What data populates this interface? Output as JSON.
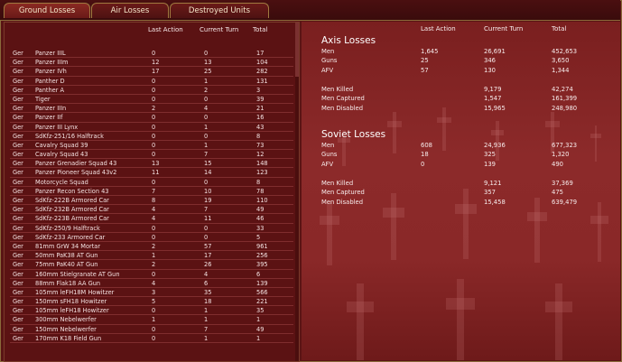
{
  "tabs": [
    {
      "label": "Ground Losses",
      "active": true
    },
    {
      "label": "Air Losses",
      "active": false
    },
    {
      "label": "Destroyed Units",
      "active": false
    }
  ],
  "left_headers": {
    "last_action": "Last Action",
    "current_turn": "Current Turn",
    "total": "Total"
  },
  "ground_rows": [
    [
      "Ger",
      "Panzer IIIL",
      "0",
      "0",
      "17"
    ],
    [
      "Ger",
      "Panzer IIIm",
      "12",
      "13",
      "104"
    ],
    [
      "Ger",
      "Panzer IVh",
      "17",
      "25",
      "282"
    ],
    [
      "Ger",
      "Panther D",
      "0",
      "1",
      "131"
    ],
    [
      "Ger",
      "Panther A",
      "0",
      "2",
      "3"
    ],
    [
      "Ger",
      "Tiger",
      "0",
      "0",
      "39"
    ],
    [
      "Ger",
      "Panzer IIIn",
      "2",
      "4",
      "21"
    ],
    [
      "Ger",
      "Panzer IIf",
      "0",
      "0",
      "16"
    ],
    [
      "Ger",
      "Panzer III Lynx",
      "0",
      "1",
      "43"
    ],
    [
      "Ger",
      "SdKfz-251/16 Halftrack",
      "0",
      "0",
      "8"
    ],
    [
      "Ger",
      "Cavalry Squad 39",
      "0",
      "1",
      "73"
    ],
    [
      "Ger",
      "Cavalry Squad 43",
      "0",
      "7",
      "12"
    ],
    [
      "Ger",
      "Panzer Grenadier Squad 43",
      "13",
      "15",
      "148"
    ],
    [
      "Ger",
      "Panzer Pioneer Squad 43v2",
      "11",
      "14",
      "123"
    ],
    [
      "Ger",
      "Motorcycle Squad",
      "0",
      "0",
      "8"
    ],
    [
      "Ger",
      "Panzer Recon Section 43",
      "7",
      "10",
      "78"
    ],
    [
      "Ger",
      "SdKfz-222B Armored Car",
      "8",
      "19",
      "110"
    ],
    [
      "Ger",
      "SdKfz-232B Armored Car",
      "4",
      "7",
      "49"
    ],
    [
      "Ger",
      "SdKfz-223B Armored Car",
      "4",
      "11",
      "46"
    ],
    [
      "Ger",
      "SdKfz-250/9 Halftrack",
      "0",
      "0",
      "33"
    ],
    [
      "Ger",
      "SdKfz-233 Armored Car",
      "0",
      "0",
      "5"
    ],
    [
      "Ger",
      "81mm GrW 34 Mortar",
      "2",
      "57",
      "961"
    ],
    [
      "Ger",
      "50mm PaK38 AT Gun",
      "1",
      "17",
      "256"
    ],
    [
      "Ger",
      "75mm PaK40 AT Gun",
      "2",
      "26",
      "395"
    ],
    [
      "Ger",
      "160mm Stielgranate AT Gun",
      "0",
      "4",
      "6"
    ],
    [
      "Ger",
      "88mm Flak18 AA Gun",
      "4",
      "6",
      "139"
    ],
    [
      "Ger",
      "105mm leFH18M Howitzer",
      "3",
      "35",
      "566"
    ],
    [
      "Ger",
      "150mm sFH18 Howitzer",
      "5",
      "18",
      "221"
    ],
    [
      "Ger",
      "105mm leFH18 Howitzer",
      "0",
      "1",
      "35"
    ],
    [
      "Ger",
      "300mm Nebelwerfer",
      "1",
      "1",
      "1"
    ],
    [
      "Ger",
      "150mm Nebelwerfer",
      "0",
      "7",
      "49"
    ],
    [
      "Ger",
      "170mm K18 Field Gun",
      "0",
      "1",
      "1"
    ]
  ],
  "right_headers": {
    "last_action": "Last Action",
    "current_turn": "Current Turn",
    "total": "Total"
  },
  "axis": {
    "title": "Axis Losses",
    "rows": [
      [
        "Men",
        "1,645",
        "26,691",
        "452,653"
      ],
      [
        "Guns",
        "25",
        "346",
        "3,650"
      ],
      [
        "AFV",
        "57",
        "130",
        "1,344"
      ]
    ],
    "casualties": [
      [
        "Men Killed",
        "",
        "9,179",
        "42,274"
      ],
      [
        "Men Captured",
        "",
        "1,547",
        "161,399"
      ],
      [
        "Men Disabled",
        "",
        "15,965",
        "248,980"
      ]
    ]
  },
  "soviet": {
    "title": "Soviet Losses",
    "rows": [
      [
        "Men",
        "608",
        "24,936",
        "677,323"
      ],
      [
        "Guns",
        "18",
        "325",
        "1,320"
      ],
      [
        "AFV",
        "0",
        "139",
        "490"
      ]
    ],
    "casualties": [
      [
        "Men Killed",
        "",
        "9,121",
        "37,369"
      ],
      [
        "Men Captured",
        "",
        "357",
        "475"
      ],
      [
        "Men Disabled",
        "",
        "15,458",
        "639,479"
      ]
    ]
  }
}
